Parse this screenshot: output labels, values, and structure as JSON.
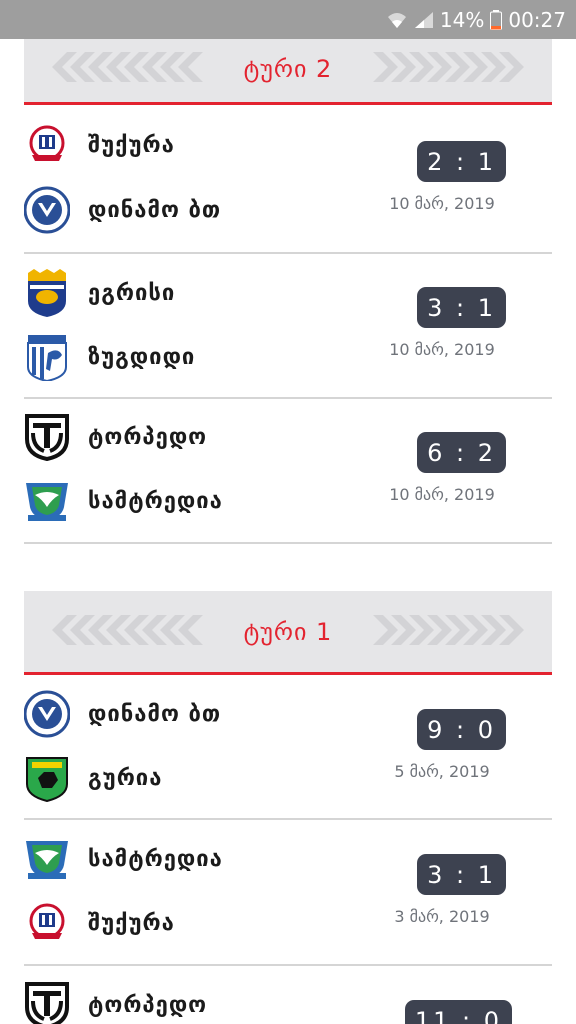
{
  "status_bar": {
    "battery": "14%",
    "time": "00:27"
  },
  "rounds": [
    {
      "title": "ტური 2",
      "matches": [
        {
          "home": "შუქურა",
          "away": "დინამო ბთ",
          "score": "2 : 1",
          "date": "10 მარ, 2019"
        },
        {
          "home": "ეგრისი",
          "away": "ზუგდიდი",
          "score": "3 : 1",
          "date": "10 მარ, 2019"
        },
        {
          "home": "ტორპედო",
          "away": "სამტრედია",
          "score": "6 : 2",
          "date": "10 მარ, 2019"
        }
      ]
    },
    {
      "title": "ტური 1",
      "matches": [
        {
          "home": "დინამო ბთ",
          "away": "გურია",
          "score": "9 : 0",
          "date": "5 მარ, 2019"
        },
        {
          "home": "სამტრედია",
          "away": "შუქურა",
          "score": "3 : 1",
          "date": "3 მარ, 2019"
        },
        {
          "home": "ტორპედო",
          "score": "11 : 0"
        }
      ]
    }
  ],
  "colors": {
    "accent": "#e3232f",
    "score_bg": "#3d4250",
    "header_bg": "#e6e6e8"
  }
}
